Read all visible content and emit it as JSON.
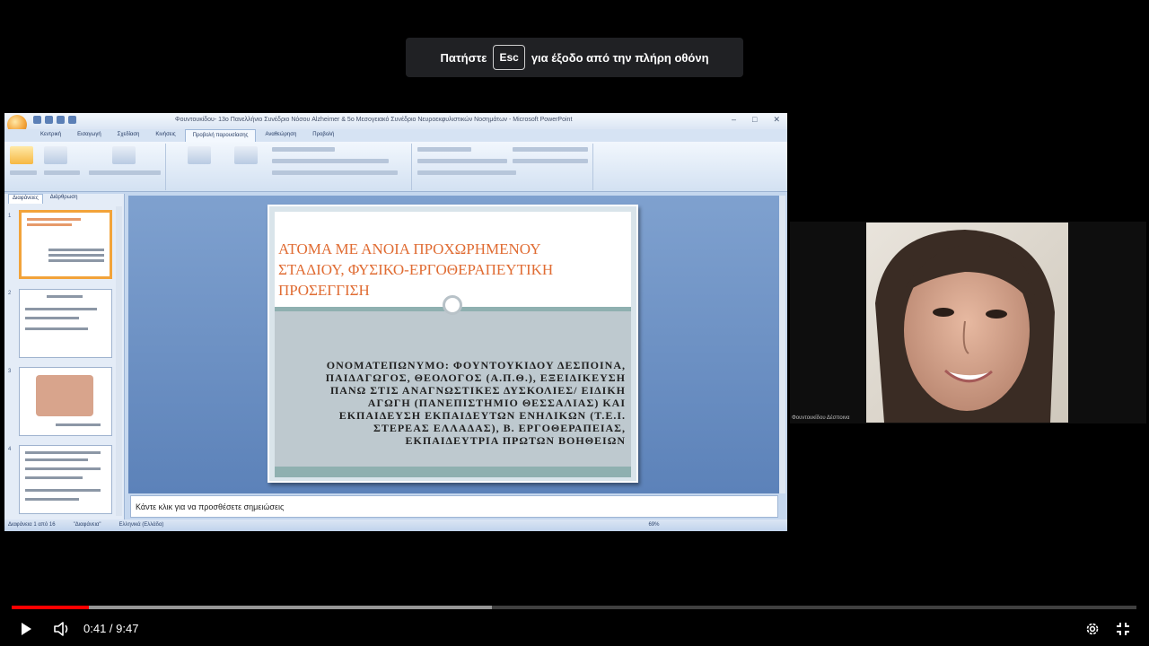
{
  "toast": {
    "before": "Πατήστε",
    "key": "Esc",
    "after": "για έξοδο από την πλήρη οθόνη"
  },
  "ppt": {
    "window_title": "Φουντουκίδου- 13ο Πανελλήνιο Συνέδριο Νόσου Alzheimer & 5ο Μεσογειακό Συνέδριο Νευροεκφυλιστικών Νοσημάτων - Microsoft PowerPoint",
    "tabs": [
      "Κεντρική",
      "Εισαγωγή",
      "Σχεδίαση",
      "Κινήσεις",
      "Προβολή παρουσίασης",
      "Αναθεώρηση",
      "Προβολή"
    ],
    "active_tab": "Προβολή παρουσίασης",
    "thumb_tabs": [
      "Διαφάνειες",
      "Διάρθρωση"
    ],
    "slide_title": "ΑΤΟΜΑ ΜΕ ΑΝΟΙΑ ΠΡΟΧΩΡΗΜΕΝΟΥ ΣΤΑΔΙΟΥ, ΦΥΣΙΚΟ-ΕΡΓΟΘΕΡΑΠΕΥΤΙΚΗ ΠΡΟΣΕΓΓΙΣΗ",
    "slide_body": "ΟΝΟΜΑΤΕΠΩΝΥΜΟ: ΦΟΥΝΤΟΥΚΙΔΟΥ ΔΕΣΠΟΙΝΑ, ΠΑΙΔΑΓΩΓΟΣ, ΘΕΟΛΟΓΟΣ (Α.Π.Θ.), ΕΞΕΙΔΙΚΕΥΣΗ ΠΑΝΩ ΣΤΙΣ ΑΝΑΓΝΩΣΤΙΚΕΣ ΔΥΣΚΟΛΙΕΣ/ ΕΙΔΙΚΗ ΑΓΩΓΗ (ΠΑΝΕΠΙΣΤΗΜΙΟ ΘΕΣΣΑΛΙΑΣ) ΚΑΙ ΕΚΠΑΙΔΕΥΣΗ ΕΚΠΑΙΔΕΥΤΩΝ ΕΝΗΛΙΚΩΝ (Τ.Ε.Ι. ΣΤΕΡΕΑΣ ΕΛΛΑΔΑΣ), Β. ΕΡΓΟΘΕΡΑΠΕΙΑΣ, ΕΚΠΑΙΔΕΥΤΡΙΑ ΠΡΩΤΩΝ ΒΟΗΘΕΙΩΝ",
    "notes_placeholder": "Κάντε κλικ για να προσθέσετε σημειώσεις",
    "status": [
      "Διαφάνεια 1 από 16",
      "\"Διαφάνεια\"",
      "Ελληνικά (Ελλάδα)",
      "69%"
    ]
  },
  "participant": {
    "name": "Φουντουκίδου Δέσποινα"
  },
  "player": {
    "time": "0:41 / 9:47",
    "played_fraction": 0.069,
    "buffered_fraction": 0.427,
    "colors": {
      "played": "#ff0000"
    }
  }
}
